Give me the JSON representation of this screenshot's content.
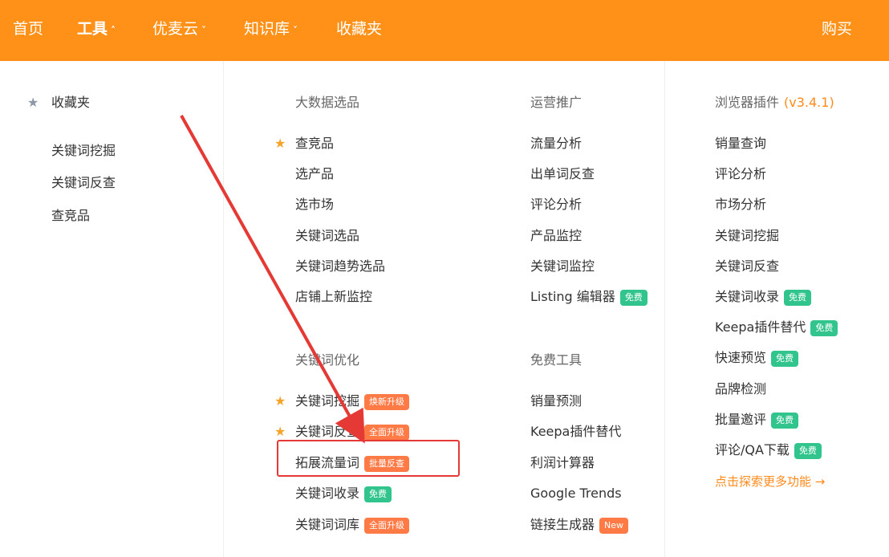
{
  "topnav": {
    "home": "首页",
    "tools": "工具",
    "youmaiyun": "优麦云",
    "knowledge": "知识库",
    "favorites": "收藏夹",
    "buy": "购买"
  },
  "favorites_col": {
    "title": "收藏夹",
    "items": [
      "关键词挖掘",
      "关键词反查",
      "查竞品"
    ]
  },
  "bigdata": {
    "title": "大数据选品",
    "items": [
      "查竞品",
      "选产品",
      "选市场",
      "关键词选品",
      "关键词趋势选品",
      "店铺上新监控"
    ]
  },
  "keyword_opt": {
    "title": "关键词优化",
    "items": [
      {
        "label": "关键词挖掘",
        "badge": "焕新升级"
      },
      {
        "label": "关键词反查",
        "badge": "全面升级"
      },
      {
        "label": "拓展流量词",
        "badge": "批量反查"
      },
      {
        "label": "关键词收录",
        "badge": "免费"
      },
      {
        "label": "关键词词库",
        "badge": "全面升级"
      }
    ]
  },
  "operations": {
    "title": "运营推广",
    "items": [
      "流量分析",
      "出单词反查",
      "评论分析",
      "产品监控",
      "关键词监控",
      "Listing 编辑器"
    ],
    "listing_badge": "免费"
  },
  "free_tools": {
    "title": "免费工具",
    "items": [
      "销量预测",
      "Keepa插件替代",
      "利润计算器",
      "Google Trends",
      "链接生成器"
    ],
    "new_badge": "New"
  },
  "plugin": {
    "title": "浏览器插件",
    "version": "(v3.4.1)",
    "items": [
      "销量查询",
      "评论分析",
      "市场分析",
      "关键词挖掘",
      "关键词反查",
      "关键词收录",
      "Keepa插件替代",
      "快速预览",
      "品牌检测",
      "批量邀评",
      "评论/QA下载"
    ],
    "badges": {
      "free": "免费"
    },
    "more": "点击探索更多功能 →"
  },
  "colors": {
    "nav_bg": "#ff9119",
    "orange_badge": "#ff7a45",
    "green_badge": "#31c48d",
    "star": "#f6a32a",
    "highlight": "#e53935"
  }
}
